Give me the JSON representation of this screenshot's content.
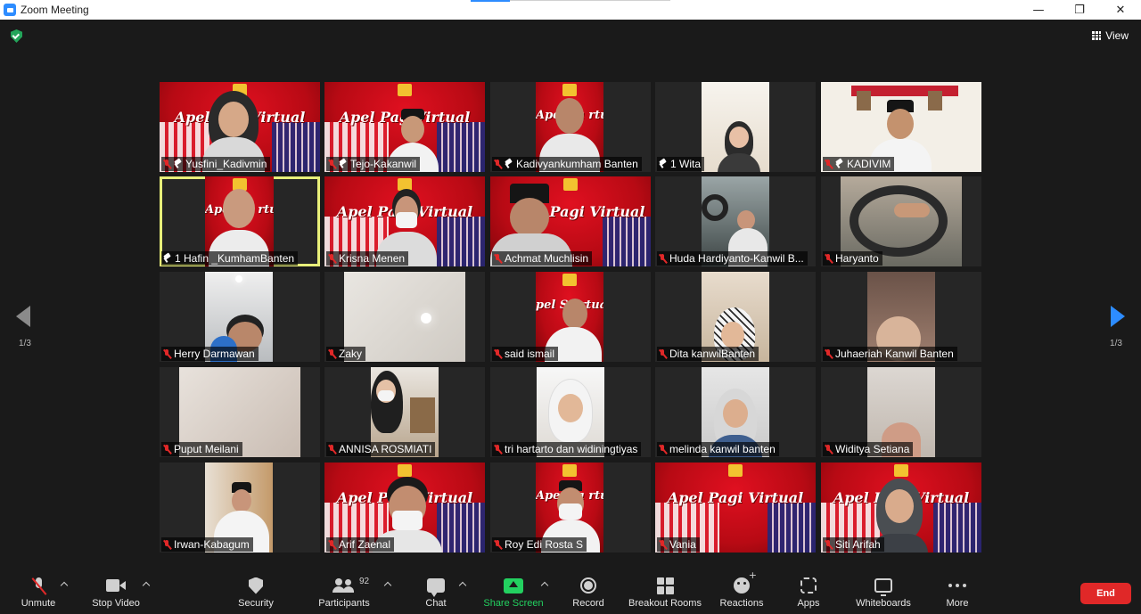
{
  "window": {
    "title": "Zoom Meeting",
    "controls": [
      "—",
      "❐",
      "✕"
    ]
  },
  "view_label": "View",
  "pagination": {
    "left": "1/3",
    "right": "1/3"
  },
  "banner": {
    "apel_pagi": "Apel Pagi Virtual",
    "apel_pagvirtual": "Apel PagiVirtual",
    "apel_pa_rtual": "Apel Pa   rtual",
    "apel_pagi_virt": "Apel Pagi Virtual",
    "apel_so_rtual": "pel So    rtual",
    "pagi_virtual": "Pagi Virtual",
    "apl": "Apel Pagi Virtual"
  },
  "participants": [
    {
      "name": "Yusfini_Kadivmin",
      "pinned": true
    },
    {
      "name": "Tejo-Kakanwil",
      "pinned": true
    },
    {
      "name": "Kadivyankumham Banten",
      "pinned": true
    },
    {
      "name": "1 Wita",
      "pinned": true,
      "muted": false
    },
    {
      "name": "KADIVIM",
      "pinned": true
    },
    {
      "name": "1 Hafin _KumhamBanten",
      "pinned": true,
      "muted": false,
      "active_speaker": true
    },
    {
      "name": "Krisna Menen"
    },
    {
      "name": "Achmat Muchlisin"
    },
    {
      "name": "Huda Hardiyanto-Kanwil B..."
    },
    {
      "name": "Haryanto"
    },
    {
      "name": "Herry Darmawan"
    },
    {
      "name": "Zaky"
    },
    {
      "name": "said ismail"
    },
    {
      "name": "Dita kanwilBanten"
    },
    {
      "name": "Juhaeriah Kanwil Banten"
    },
    {
      "name": "Puput Meilani"
    },
    {
      "name": "ANNISA ROSMIATI"
    },
    {
      "name": "tri hartarto dan widiningtiyas"
    },
    {
      "name": "melinda kanwil banten"
    },
    {
      "name": "Widitya Setiana"
    },
    {
      "name": "Irwan-Kabagum"
    },
    {
      "name": "Arif Zaenal"
    },
    {
      "name": "Roy Edi Rosta S"
    },
    {
      "name": "Vania"
    },
    {
      "name": "Siti Arifah"
    }
  ],
  "toolbar": {
    "unmute": "Unmute",
    "stop_video": "Stop Video",
    "security": "Security",
    "participants": "Participants",
    "participants_count": "92",
    "chat": "Chat",
    "share_screen": "Share Screen",
    "record": "Record",
    "breakout_rooms": "Breakout Rooms",
    "reactions": "Reactions",
    "apps": "Apps",
    "whiteboards": "Whiteboards",
    "more": "More",
    "end": "End"
  },
  "colors": {
    "accent": "#2d8cff",
    "share_green": "#23d160",
    "end_red": "#e02828",
    "active_speaker": "#e8ef7a",
    "muted_red": "#e02828"
  }
}
